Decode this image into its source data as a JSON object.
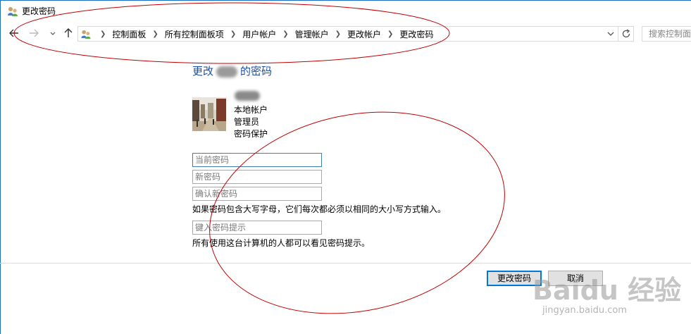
{
  "window": {
    "title": "更改密码",
    "icon": "user-accounts-icon"
  },
  "nav": {
    "back_icon": "arrow-left-icon",
    "forward_icon": "arrow-right-icon",
    "recent_icon": "chevron-down-icon",
    "up_icon": "arrow-up-icon"
  },
  "address": {
    "crumbs": [
      "控制面板",
      "所有控制面板项",
      "用户帐户",
      "管理帐户",
      "更改帐户",
      "更改密码"
    ],
    "dropdown_icon": "chevron-down-icon",
    "refresh_icon": "refresh-icon"
  },
  "search": {
    "placeholder": "搜索控制面板"
  },
  "main": {
    "heading_prefix": "更改",
    "heading_suffix": "的密码",
    "account": {
      "type": "本地帐户",
      "role": "管理员",
      "protection": "密码保护"
    },
    "fields": {
      "current_password_placeholder": "当前密码",
      "new_password_placeholder": "新密码",
      "confirm_password_placeholder": "确认新密码",
      "hint_placeholder": "键入密码提示"
    },
    "case_note": "如果密码包含大写字母，它们每次都必须以相同的大小写方式输入。",
    "hint_note": "所有使用这台计算机的人都可以看见密码提示。"
  },
  "buttons": {
    "change": "更改密码",
    "cancel": "取消"
  },
  "watermark": {
    "brand": "Baidu 经验",
    "url": "jingyan.baidu.com"
  },
  "colors": {
    "heading": "#1e50a2",
    "annotation": "#c00000",
    "primary_border": "#0078d7"
  }
}
